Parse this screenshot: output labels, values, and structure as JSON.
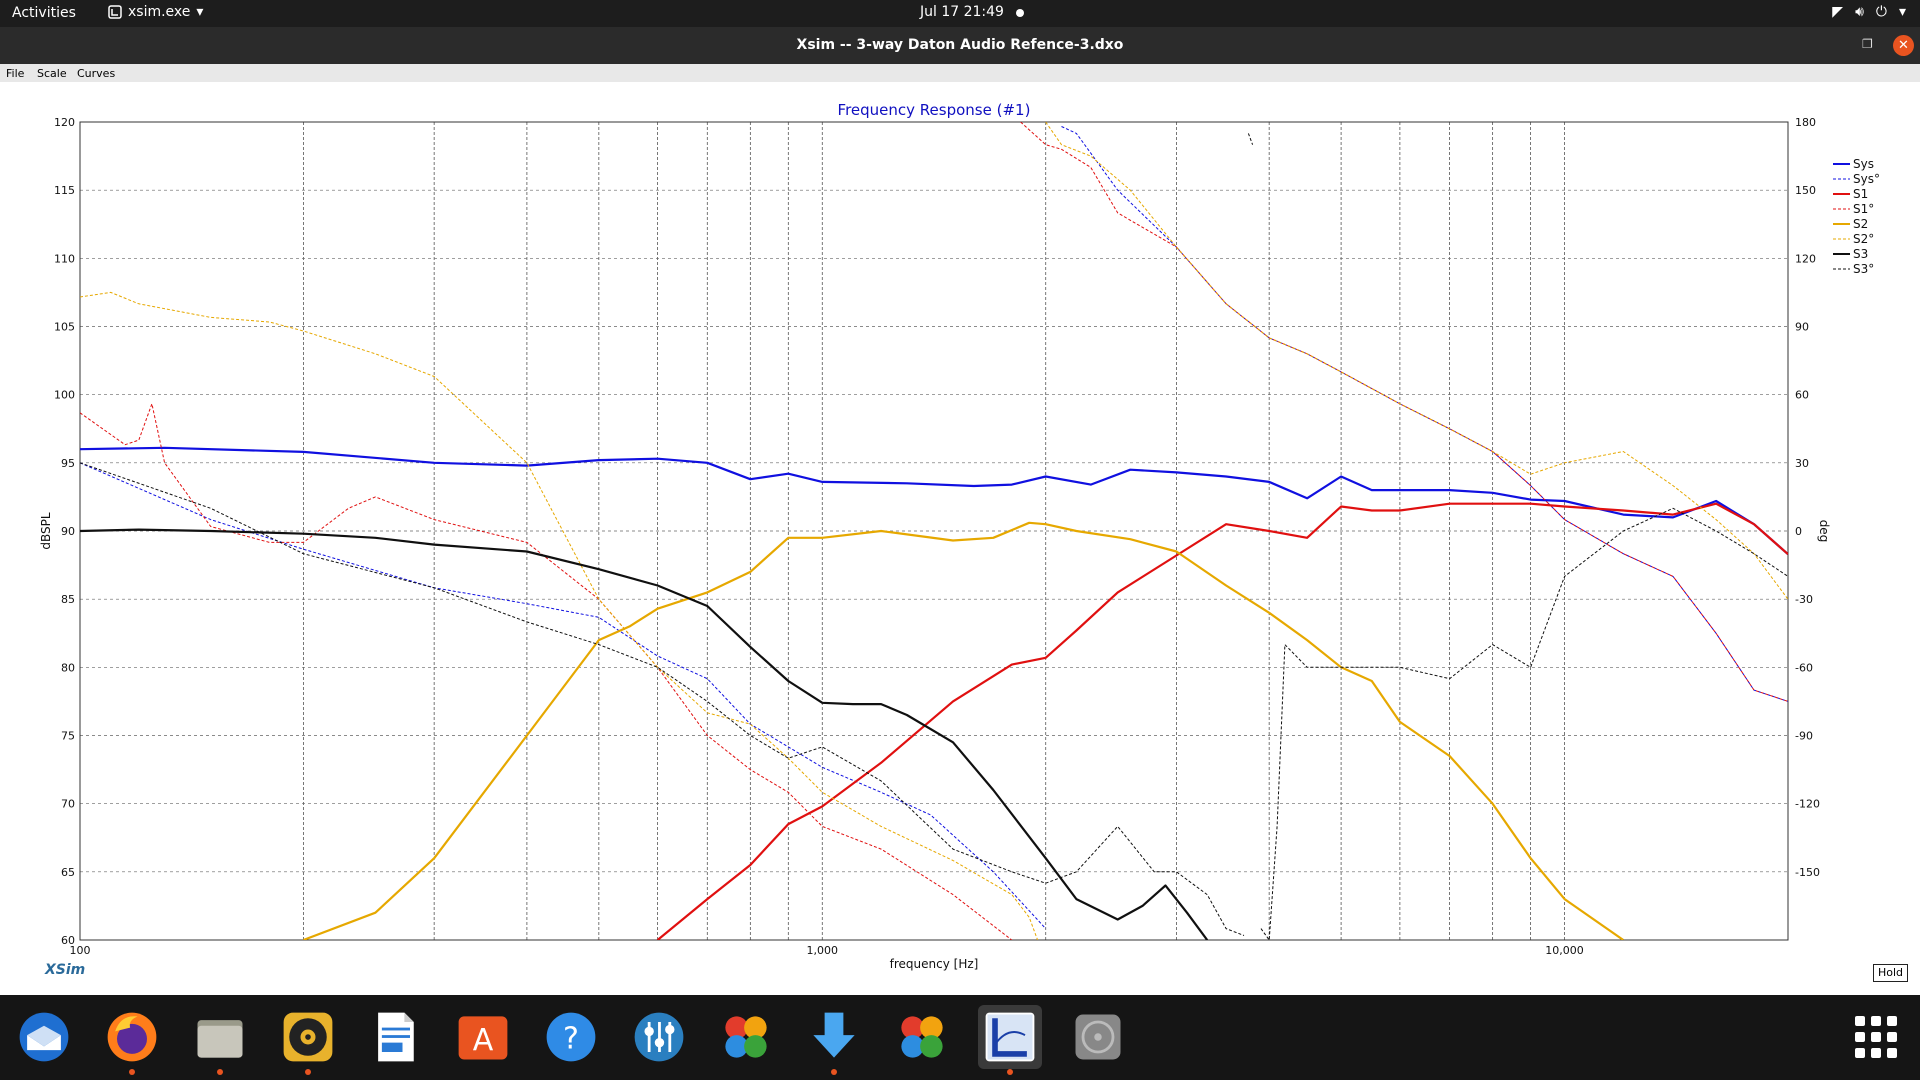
{
  "topbar": {
    "activities": "Activities",
    "app_name": "xsim.exe",
    "clock": "Jul 17  21:49"
  },
  "window": {
    "title": "Xsim -- 3-way Daton Audio Refence-3.dxo"
  },
  "menu": {
    "items": [
      "File",
      "Scale",
      "Curves"
    ]
  },
  "footer": {
    "brand": "XSim",
    "hold_label": "Hold"
  },
  "dock": {
    "apps": [
      {
        "name": "thunderbird-icon",
        "running": false
      },
      {
        "name": "firefox-icon",
        "running": true
      },
      {
        "name": "files-icon",
        "running": true
      },
      {
        "name": "rhythmbox-icon",
        "running": true
      },
      {
        "name": "writer-icon",
        "running": false
      },
      {
        "name": "app-center-icon",
        "running": false
      },
      {
        "name": "help-icon",
        "running": false
      },
      {
        "name": "mixer-icon",
        "running": false
      },
      {
        "name": "wine-clover-icon",
        "running": false
      },
      {
        "name": "downloader-icon",
        "running": true
      },
      {
        "name": "wine-clover-icon-2",
        "running": false
      },
      {
        "name": "xsim-icon",
        "running": true,
        "active": true
      },
      {
        "name": "disk-icon",
        "running": false
      }
    ]
  },
  "chart_data": {
    "type": "line",
    "title": "Frequency Response (#1)",
    "xlabel": "frequency [Hz]",
    "ylabel": "dBSPL",
    "y2label": "deg",
    "xscale": "log",
    "xlim": [
      100,
      20000
    ],
    "ylim": [
      60,
      120
    ],
    "y2lim": [
      -180,
      180
    ],
    "x_ticks": [
      {
        "value": 100,
        "label": "100"
      },
      {
        "value": 1000,
        "label": "1,000"
      },
      {
        "value": 10000,
        "label": "10,000"
      }
    ],
    "y_ticks": [
      60,
      65,
      70,
      75,
      80,
      85,
      90,
      95,
      100,
      105,
      110,
      115,
      120
    ],
    "y2_ticks": [
      -150,
      -120,
      -90,
      -60,
      -30,
      0,
      30,
      60,
      90,
      120,
      150,
      180
    ],
    "grid": true,
    "legend_position": "right",
    "series": [
      {
        "name": "Sys",
        "axis": "left",
        "style": "solid",
        "color": "#1010e0",
        "x": [
          100,
          130,
          200,
          300,
          400,
          500,
          600,
          700,
          800,
          900,
          1000,
          1300,
          1600,
          1800,
          2000,
          2300,
          2600,
          3000,
          3500,
          4000,
          4500,
          5000,
          5500,
          6000,
          7000,
          8000,
          9000,
          10000,
          12000,
          14000,
          16000,
          18000,
          20000
        ],
        "y": [
          96,
          96.1,
          95.8,
          95,
          94.8,
          95.2,
          95.3,
          95,
          93.8,
          94.2,
          93.6,
          93.5,
          93.3,
          93.4,
          94,
          93.4,
          94.5,
          94.3,
          94,
          93.6,
          92.4,
          94,
          93,
          93,
          93,
          92.8,
          92.3,
          92.2,
          91.2,
          91,
          92.2,
          90.5,
          88.3
        ]
      },
      {
        "name": "Sys°",
        "axis": "right",
        "style": "dashed",
        "color": "#1010e0",
        "x": [
          100,
          150,
          200,
          300,
          400,
          500,
          600,
          700,
          800,
          900,
          1000,
          1200,
          1400,
          1700,
          2000,
          2100,
          2200,
          2500,
          3000,
          3500,
          4000,
          4500,
          5000,
          6000,
          7000,
          8000,
          9000,
          10000,
          12000,
          14000,
          16000,
          18000,
          20000
        ],
        "y": [
          30,
          5,
          -8,
          -25,
          -32,
          -38,
          -55,
          -65,
          -85,
          -95,
          -104,
          -115,
          -125,
          -150,
          -175,
          178,
          175,
          150,
          125,
          100,
          85,
          78,
          70,
          56,
          45,
          35,
          20,
          5,
          -10,
          -20,
          -45,
          -70,
          -75
        ]
      },
      {
        "name": "S1",
        "axis": "left",
        "style": "solid",
        "color": "#e01010",
        "x": [
          600,
          700,
          800,
          900,
          1000,
          1200,
          1500,
          1800,
          2000,
          2200,
          2500,
          3000,
          3500,
          4000,
          4500,
          5000,
          5500,
          6000,
          7000,
          8000,
          9000,
          10000,
          12000,
          14000,
          16000,
          18000,
          20000
        ],
        "y": [
          60,
          63,
          65.5,
          68.5,
          69.8,
          73,
          77.5,
          80.2,
          80.7,
          82.7,
          85.5,
          88.2,
          90.5,
          90,
          89.5,
          91.8,
          91.5,
          91.5,
          92,
          92,
          92,
          91.8,
          91.5,
          91.2,
          92,
          90.5,
          88.3
        ]
      },
      {
        "name": "S1°",
        "axis": "right",
        "style": "dashed",
        "color": "#e01010",
        "x": [
          100,
          115,
          120,
          125,
          130,
          150,
          180,
          200,
          230,
          250,
          300,
          400,
          500,
          600,
          700,
          800,
          900,
          1000,
          1200,
          1500,
          1800,
          1850,
          2000,
          2100,
          2300,
          2500,
          3000,
          3500,
          4000,
          4500,
          5000,
          6000,
          7000,
          8000,
          9000,
          10000,
          12000,
          14000,
          16000,
          18000,
          20000
        ],
        "y": [
          52,
          38,
          40,
          56,
          30,
          2,
          -5,
          -5,
          10,
          15,
          5,
          -5,
          -30,
          -60,
          -90,
          -105,
          -115,
          -130,
          -140,
          -160,
          -180,
          180,
          170,
          168,
          160,
          140,
          125,
          100,
          85,
          78,
          70,
          56,
          45,
          35,
          20,
          5,
          -10,
          -20,
          -45,
          -70,
          -75
        ]
      },
      {
        "name": "S2",
        "axis": "left",
        "style": "solid",
        "color": "#e6a800",
        "x": [
          200,
          250,
          300,
          400,
          500,
          550,
          600,
          700,
          800,
          900,
          1000,
          1200,
          1500,
          1700,
          1900,
          2000,
          2200,
          2600,
          3000,
          3500,
          4000,
          4500,
          5000,
          5500,
          6000,
          7000,
          8000,
          9000,
          10000,
          12000
        ],
        "y": [
          60,
          62,
          66,
          75,
          82,
          83,
          84.3,
          85.5,
          87,
          89.5,
          89.5,
          90,
          89.3,
          89.5,
          90.6,
          90.5,
          90,
          89.4,
          88.5,
          86,
          84,
          82,
          80,
          79,
          76,
          73.5,
          70,
          66,
          63,
          60
        ]
      },
      {
        "name": "S2°",
        "axis": "right",
        "style": "dashed",
        "color": "#e6a800",
        "x": [
          100,
          110,
          120,
          150,
          180,
          200,
          250,
          300,
          400,
          500,
          600,
          700,
          800,
          900,
          1000,
          1200,
          1500,
          1800,
          1900,
          1950,
          2000,
          2100,
          2300,
          2600,
          3000,
          3500,
          4000,
          4500,
          5000,
          6000,
          7000,
          8000,
          9000,
          10000,
          12000,
          14000,
          16000,
          18000,
          20000
        ],
        "y": [
          103,
          105,
          100,
          94,
          92,
          88,
          78,
          68,
          30,
          -30,
          -60,
          -80,
          -85,
          -100,
          -115,
          -130,
          -145,
          -160,
          -170,
          -180,
          180,
          170,
          165,
          150,
          125,
          100,
          85,
          78,
          70,
          56,
          45,
          35,
          25,
          30,
          35,
          20,
          5,
          -10,
          -30
        ]
      },
      {
        "name": "S3",
        "axis": "left",
        "style": "solid",
        "color": "#101010",
        "x": [
          100,
          120,
          150,
          200,
          250,
          300,
          400,
          500,
          600,
          700,
          800,
          900,
          1000,
          1100,
          1200,
          1300,
          1500,
          1700,
          2000,
          2200,
          2500,
          2700,
          2900,
          3100,
          3300
        ],
        "y": [
          90,
          90.1,
          90,
          89.8,
          89.5,
          89,
          88.5,
          87.2,
          86,
          84.5,
          81.5,
          79,
          77.4,
          77.3,
          77.3,
          76.5,
          74.5,
          71,
          66,
          63,
          61.5,
          62.5,
          64,
          62,
          60
        ]
      },
      {
        "name": "S3°",
        "axis": "right",
        "style": "dashed",
        "color": "#101010",
        "x": [
          100,
          150,
          200,
          300,
          400,
          500,
          600,
          700,
          800,
          900,
          1000,
          1200,
          1500,
          1800,
          2000,
          2200,
          2500,
          2800,
          3000,
          3300,
          3500,
          3700,
          3750,
          3800,
          3900,
          4000,
          4100,
          4200,
          4500,
          5000,
          5500,
          6000,
          7000,
          8000,
          9000,
          10000,
          12000,
          14000,
          16000,
          18000,
          20000
        ],
        "y": [
          30,
          10,
          -10,
          -25,
          -40,
          -50,
          -60,
          -75,
          -90,
          -100,
          -95,
          -110,
          -140,
          -150,
          -155,
          -150,
          -130,
          -150,
          -150,
          -160,
          -175,
          -178,
          175,
          170,
          -175,
          -180,
          -130,
          -50,
          -60,
          -60,
          -60,
          -60,
          -65,
          -50,
          -60,
          -20,
          0,
          10,
          0,
          -10,
          -20
        ]
      }
    ]
  }
}
